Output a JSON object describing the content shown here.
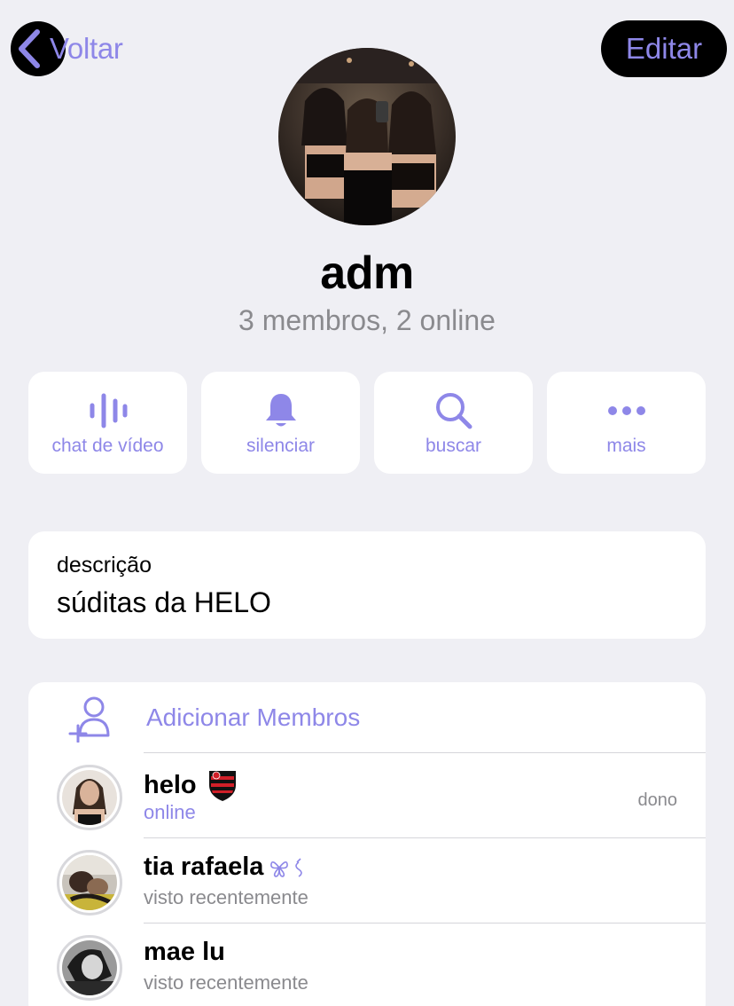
{
  "nav": {
    "back_label": "Voltar",
    "edit_label": "Editar"
  },
  "group": {
    "name": "adm",
    "subtitle": "3 membros, 2 online"
  },
  "actions": [
    {
      "label": "chat de vídeo",
      "icon": "waveform-icon"
    },
    {
      "label": "silenciar",
      "icon": "bell-icon"
    },
    {
      "label": "buscar",
      "icon": "search-icon"
    },
    {
      "label": "mais",
      "icon": "more-dots-icon"
    }
  ],
  "description": {
    "title": "descrição",
    "text": "súditas da HELO"
  },
  "members": {
    "add_label": "Adicionar Membros",
    "list": [
      {
        "name": "helo",
        "status": "online",
        "role": "dono",
        "emoji": "flamengo-badge-icon"
      },
      {
        "name": "tia rafaela",
        "status": "visto recentemente",
        "role": "",
        "emoji": "butterfly-icon"
      },
      {
        "name": "mae lu",
        "status": "visto recentemente",
        "role": ""
      }
    ]
  },
  "colors": {
    "accent": "#8e87e8",
    "background": "#efeff4",
    "card": "#ffffff",
    "secondary_text": "#8a8a8e",
    "online": "#8e87e8"
  }
}
